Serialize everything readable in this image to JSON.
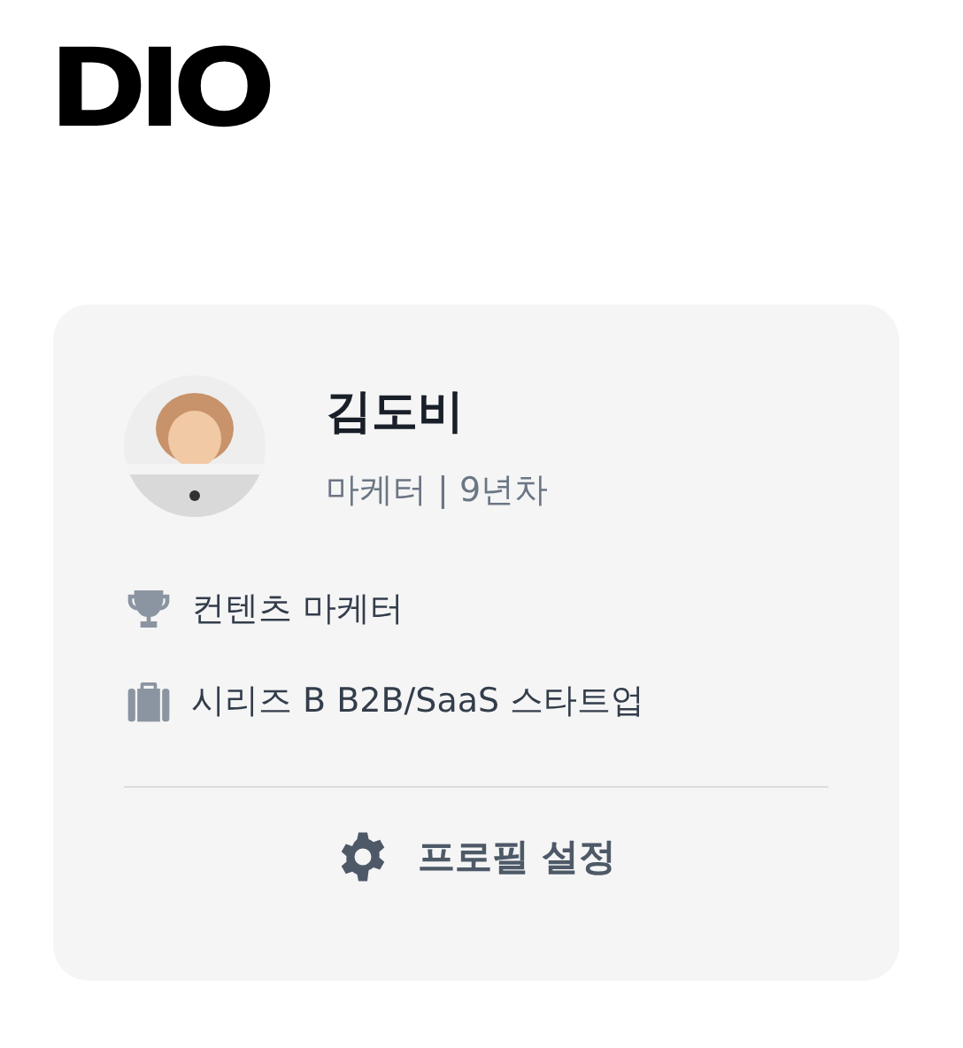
{
  "logo": "DIO",
  "profile": {
    "name": "김도비",
    "subtitle": "마케터 | 9년차"
  },
  "details": [
    {
      "kind": "trophy",
      "text": "컨텐츠 마케터"
    },
    {
      "kind": "briefcase",
      "text": "시리즈 B B2B/SaaS 스타트업"
    }
  ],
  "settings_button": "프로필 설정"
}
